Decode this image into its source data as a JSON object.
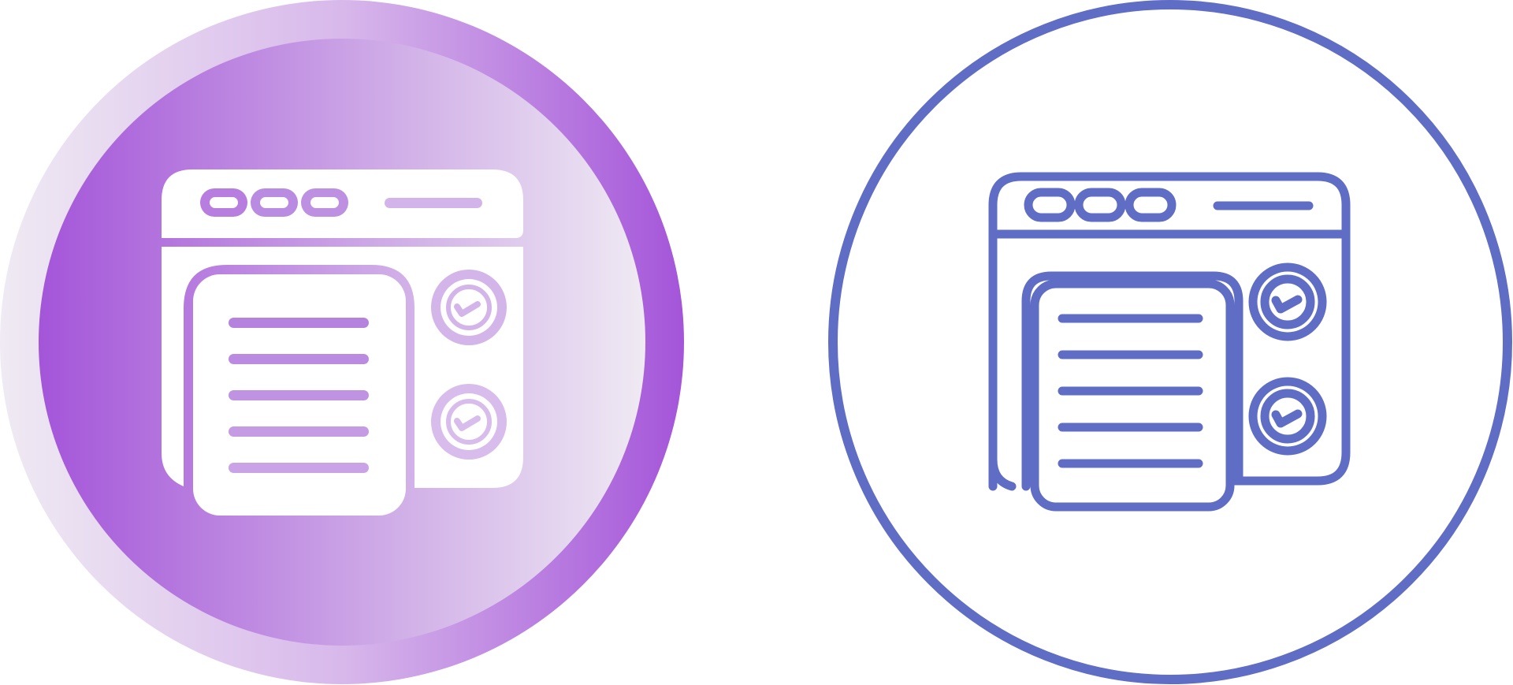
{
  "icons": [
    {
      "name": "browser-checklist-glyph-icon",
      "style": "glyph-gradient",
      "colors": {
        "gradient_start": "#a455d9",
        "gradient_mid": "#d8b8eb",
        "gradient_end": "#efeaf3",
        "fill": "#ffffff"
      }
    },
    {
      "name": "browser-checklist-outline-icon",
      "style": "outline",
      "colors": {
        "stroke": "#5f6dc4",
        "background": "#ffffff"
      }
    }
  ]
}
